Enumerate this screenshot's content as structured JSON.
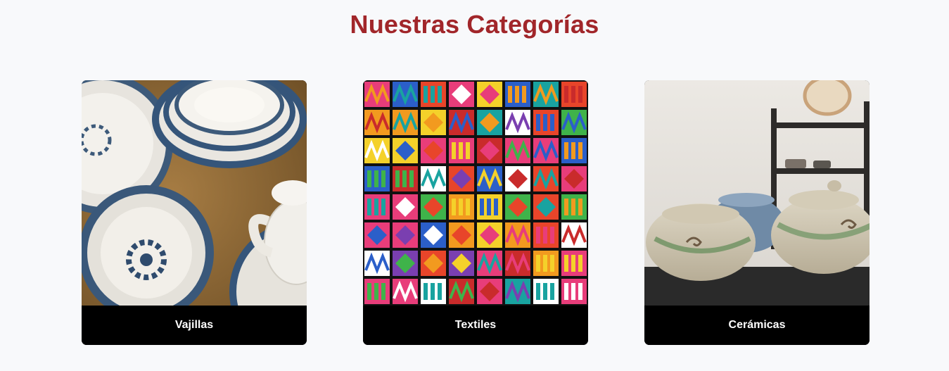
{
  "section": {
    "title": "Nuestras Categorías"
  },
  "categories": [
    {
      "label": "Vajillas",
      "image": "blue-white-porcelain-dishes"
    },
    {
      "label": "Textiles",
      "image": "colorful-woven-textile"
    },
    {
      "label": "Cerámicas",
      "image": "ceramic-pots"
    }
  ],
  "colors": {
    "title": "#a1262a",
    "background": "#f8f9fb",
    "card_label_bg": "#000000",
    "card_label_text": "#ffffff"
  }
}
